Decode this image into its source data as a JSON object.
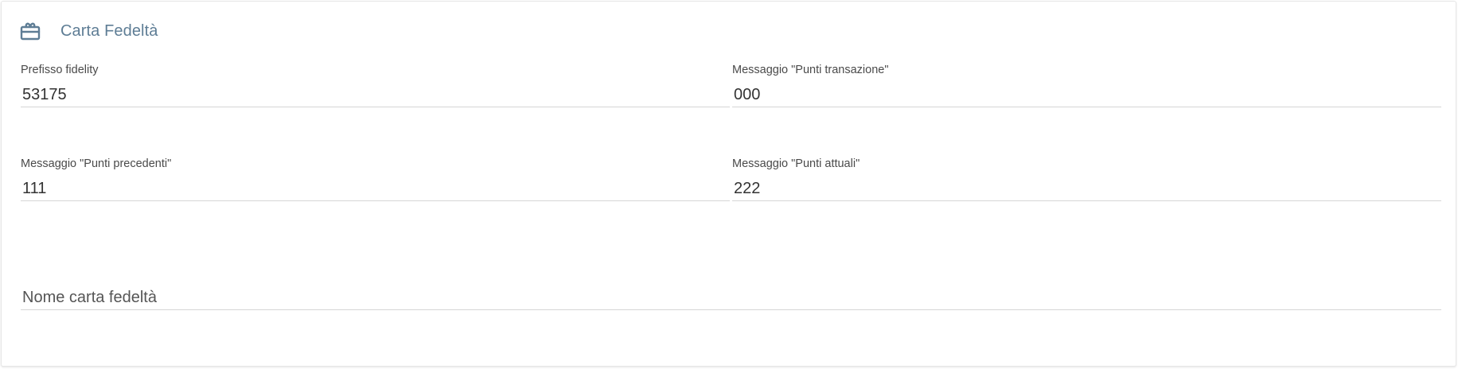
{
  "card": {
    "title": "Carta Fedeltà",
    "icon": "gift-card-icon",
    "colors": {
      "title": "#5e7d95",
      "icon": "#5e7d95",
      "underline": "#d6d6d6"
    }
  },
  "fields": {
    "prefisso_fidelity": {
      "label": "Prefisso fidelity",
      "value": "53175"
    },
    "messaggio_punti_transazione": {
      "label": "Messaggio \"Punti transazione\"",
      "value": "000"
    },
    "messaggio_punti_precedenti": {
      "label": "Messaggio \"Punti precedenti\"",
      "value": "111"
    },
    "messaggio_punti_attuali": {
      "label": "Messaggio \"Punti attuali\"",
      "value": "222"
    },
    "nome_carta_fedelta": {
      "placeholder": "Nome carta fedeltà",
      "value": ""
    }
  }
}
